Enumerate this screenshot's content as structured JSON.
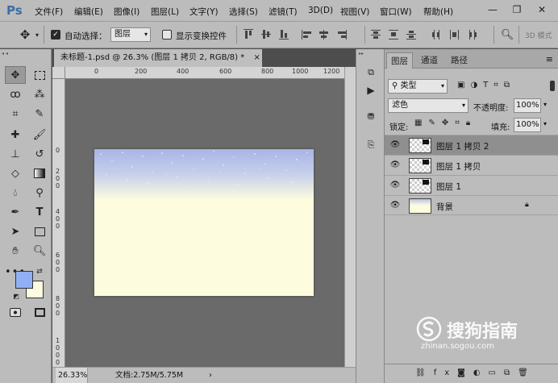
{
  "app": {
    "logo": "Ps"
  },
  "menu": [
    "文件(F)",
    "编辑(E)",
    "图像(I)",
    "图层(L)",
    "文字(Y)",
    "选择(S)",
    "滤镜(T)",
    "3D(D)",
    "视图(V)",
    "窗口(W)",
    "帮助(H)"
  ],
  "options": {
    "auto_select_label": "自动选择：",
    "auto_select_value": "图层",
    "show_transform_label": "显示变换控件",
    "mode_3d": "3D 模式"
  },
  "document": {
    "tab_title": "未标题-1.psd @ 26.3% (图层 1 拷贝 2, RGB/8) *",
    "close_glyph": "×",
    "ruler_h": [
      "0",
      "200",
      "400",
      "600",
      "800",
      "1000",
      "1200"
    ],
    "ruler_v": [
      "0",
      "2 0 0",
      "4 0 0",
      "6 0 0",
      "8 0 0",
      "1 0 0 0"
    ],
    "zoom": "26.33%",
    "doc_size": "文档:2.75M/5.75M",
    "arrow": "›"
  },
  "layers_panel": {
    "tabs": [
      "图层",
      "通道",
      "路径"
    ],
    "filter_kind": "类型",
    "blend_mode": "滤色",
    "opacity_label": "不透明度:",
    "opacity_value": "100%",
    "lock_label": "锁定:",
    "fill_label": "填充:",
    "fill_value": "100%",
    "layers": [
      {
        "name": "图层 1 拷贝 2",
        "selected": true
      },
      {
        "name": "图层 1 拷贝",
        "selected": false
      },
      {
        "name": "图层 1",
        "selected": false
      },
      {
        "name": "背景",
        "selected": false
      }
    ]
  },
  "watermark": {
    "brand": "搜狗指南",
    "url": "zhinan.sogou.com"
  },
  "colors": {
    "foreground": "#8fb0f4",
    "background": "#fdfcdf"
  }
}
